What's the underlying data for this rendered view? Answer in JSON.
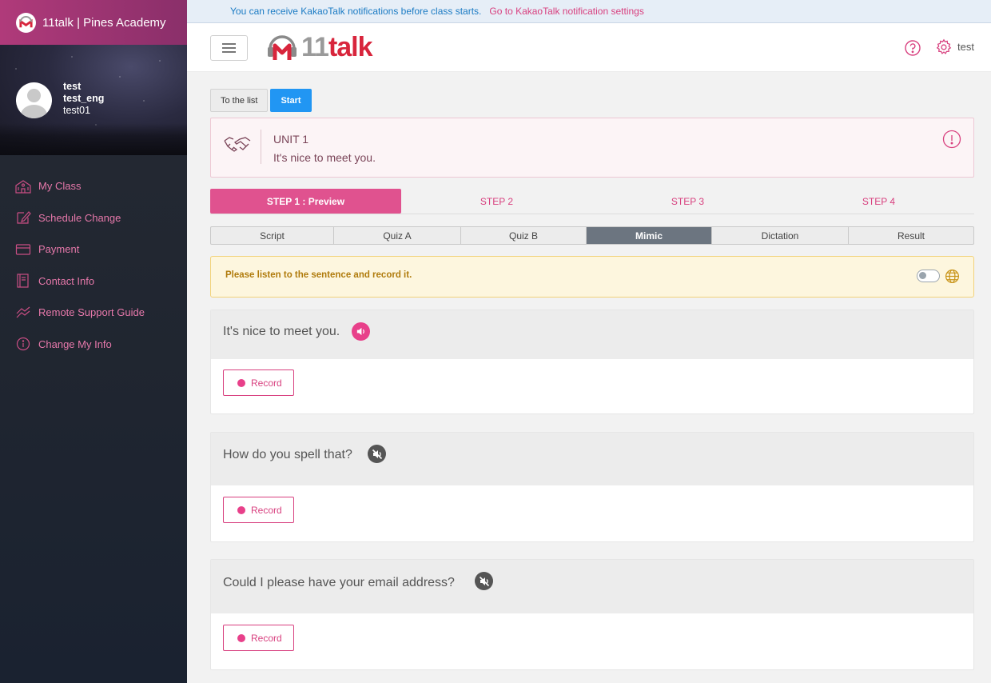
{
  "sidebar": {
    "brand": "11talk | Pines Academy",
    "profile": {
      "name": "test",
      "eng_name": "test_eng",
      "user_id": "test01"
    },
    "items": [
      {
        "label": "My Class",
        "icon": "school-icon"
      },
      {
        "label": "Schedule Change",
        "icon": "edit-icon"
      },
      {
        "label": "Payment",
        "icon": "card-icon"
      },
      {
        "label": "Contact Info",
        "icon": "book-icon"
      },
      {
        "label": "Remote Support Guide",
        "icon": "remote-icon"
      },
      {
        "label": "Change My Info",
        "icon": "info-icon"
      }
    ]
  },
  "notice": {
    "text": "You can receive KakaoTalk notifications before class starts.",
    "link": "Go to KakaoTalk notification settings"
  },
  "header": {
    "logo_text_gray": "11",
    "logo_text_red": "talk",
    "username": "test"
  },
  "actions": {
    "to_list": "To the list",
    "start": "Start"
  },
  "unit": {
    "title": "UNIT 1",
    "subtitle": "It's nice to meet you."
  },
  "steps": [
    "STEP 1 : Preview",
    "STEP 2",
    "STEP 3",
    "STEP 4"
  ],
  "active_step": 0,
  "subtabs": [
    "Script",
    "Quiz A",
    "Quiz B",
    "Mimic",
    "Dictation",
    "Result"
  ],
  "active_subtab": "Mimic",
  "instruction": "Please listen to the sentence and record it.",
  "sentences": [
    {
      "text": "It's nice to meet you.",
      "audio": "speaker-on-icon"
    },
    {
      "text": "How do you spell that?",
      "audio": "speaker-muted-icon"
    },
    {
      "text": "Could I please have your email address?",
      "audio": "speaker-muted-icon"
    }
  ],
  "record_label": "Record",
  "colors": {
    "accent": "#e0528f",
    "brand": "#d8253c",
    "start": "#2196f3",
    "warning_bg": "#fdf6de"
  }
}
